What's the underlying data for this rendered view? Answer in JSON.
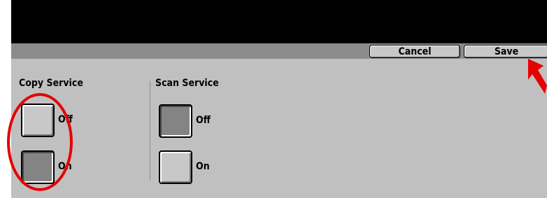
{
  "toolbar": {
    "cancel_label": "Cancel",
    "save_label": "Save"
  },
  "copy_service": {
    "title": "Copy Service",
    "off_label": "Off",
    "on_label": "On",
    "selected": "On"
  },
  "scan_service": {
    "title": "Scan Service",
    "off_label": "Off",
    "on_label": "On",
    "selected": "Off"
  },
  "colors": {
    "title_bar": "#000000",
    "toolbar": "#8c8c8c",
    "panel": "#c0c0c0",
    "highlight": "#e60000"
  },
  "annotations": {
    "highlight_target": "copy-service-options",
    "arrow_target": "save-button"
  }
}
